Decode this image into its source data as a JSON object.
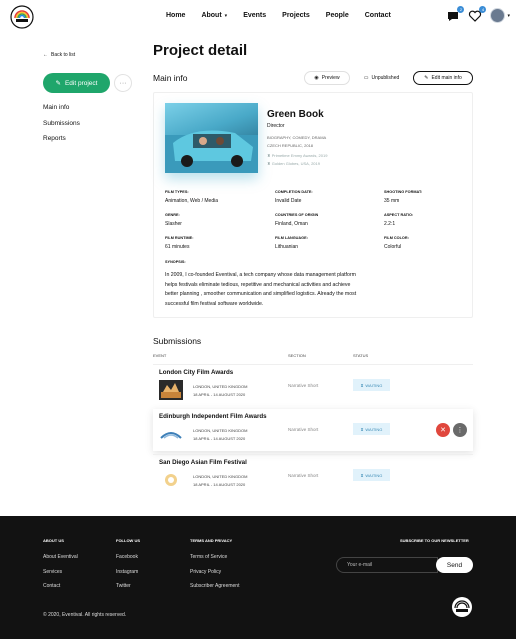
{
  "header": {
    "nav": [
      "Home",
      "About",
      "Events",
      "Projects",
      "People",
      "Contact"
    ],
    "about_has_dropdown": true,
    "notifications": [
      {
        "icon": "message-icon",
        "badge": "2"
      },
      {
        "icon": "heart-icon",
        "badge": "4"
      }
    ],
    "brand_color": "#1fa66b",
    "accent_color": "#3b8dd6"
  },
  "sidebar": {
    "back_label": "Back to list",
    "edit_label": "Edit project",
    "more_label": "···",
    "links": [
      "Main info",
      "Submissions",
      "Reports"
    ]
  },
  "page": {
    "title": "Project detail",
    "main_info_title": "Main info",
    "toolbar": {
      "preview": "Preview",
      "unpublished": "Unpublished",
      "edit_main": "Edit main info"
    }
  },
  "film": {
    "title": "Green Book",
    "role": "Director",
    "genre_line1": "BIOGRAPHY, COMEDY, DRAMA",
    "genre_line2": "CZECH REPUBLIC, 2018",
    "awards": [
      "Primetime Emmy Awards, 2019",
      "Golden Globes, USA, 2019"
    ],
    "info": [
      {
        "label": "FILM TYPES:",
        "value": "Animation, Web / Media"
      },
      {
        "label": "COMPLETION DATE:",
        "value": "Invalid Date"
      },
      {
        "label": "SHOOTING FORMAT:",
        "value": "35 mm"
      },
      {
        "label": "GENRE:",
        "value": "Slasher"
      },
      {
        "label": "COUNTRIES OF ORIGIN",
        "value": "Finland, Oman"
      },
      {
        "label": "ASPECT RATIO:",
        "value": "2.2:1"
      },
      {
        "label": "FILM RUNTIME:",
        "value": "61 minutes"
      },
      {
        "label": "FILM LANGUAGE:",
        "value": "Lithuanian"
      },
      {
        "label": "FILM COLOR:",
        "value": "Colorful"
      }
    ],
    "synopsis_label": "SYNOPSIS:",
    "synopsis": "In 2009, I co-founded Eventival, a tech company whose data management platform helps festivals eliminate tedious, repetitive and mechanical activities and achieve better planning , smoother communication and simplified logistics. Already the most successful film festival software worldwide."
  },
  "submissions": {
    "title": "Submissions",
    "columns": [
      "EVENT",
      "SECTION",
      "STATUS"
    ],
    "rows": [
      {
        "event": "London City Film Awards",
        "location": "LONDON, UNITED KINGDOM",
        "dates": "18 APRIL - 14 AUGUST 2020",
        "section": "Narrative Short",
        "status": "WAITING"
      },
      {
        "event": "Edinburgh Independent Film Awards",
        "location": "LONDON, UNITED KINGDOM",
        "dates": "18 APRIL - 14 AUGUST 2020",
        "section": "Narrative Short",
        "status": "WAITING"
      },
      {
        "event": "San Diego Asian Film Festival",
        "location": "LONDON, UNITED KINGDOM",
        "dates": "18 APRIL - 14 AUGUST 2020",
        "section": "Narrative Short",
        "status": "WAITING"
      }
    ],
    "delete_label": "✕",
    "more_label": "⋮"
  },
  "footer": {
    "about_hdr": "ABOUT US",
    "about_links": [
      "About Eventival",
      "Services",
      "Contact"
    ],
    "follow_hdr": "FOLLOW US",
    "follow_links": [
      "Facebook",
      "Instagram",
      "Twitter"
    ],
    "terms_hdr": "TERMS AND PRIVACY",
    "terms_links": [
      "Terms of Service",
      "Privacy Policy",
      "Subscriber Agreement"
    ],
    "newsletter_hdr": "SUBSCRIBE TO OUR NEWSLETTER",
    "email_placeholder": "Your e-mail",
    "send_label": "Send",
    "copyright": "© 2020, Eventival. All rights reserved."
  }
}
